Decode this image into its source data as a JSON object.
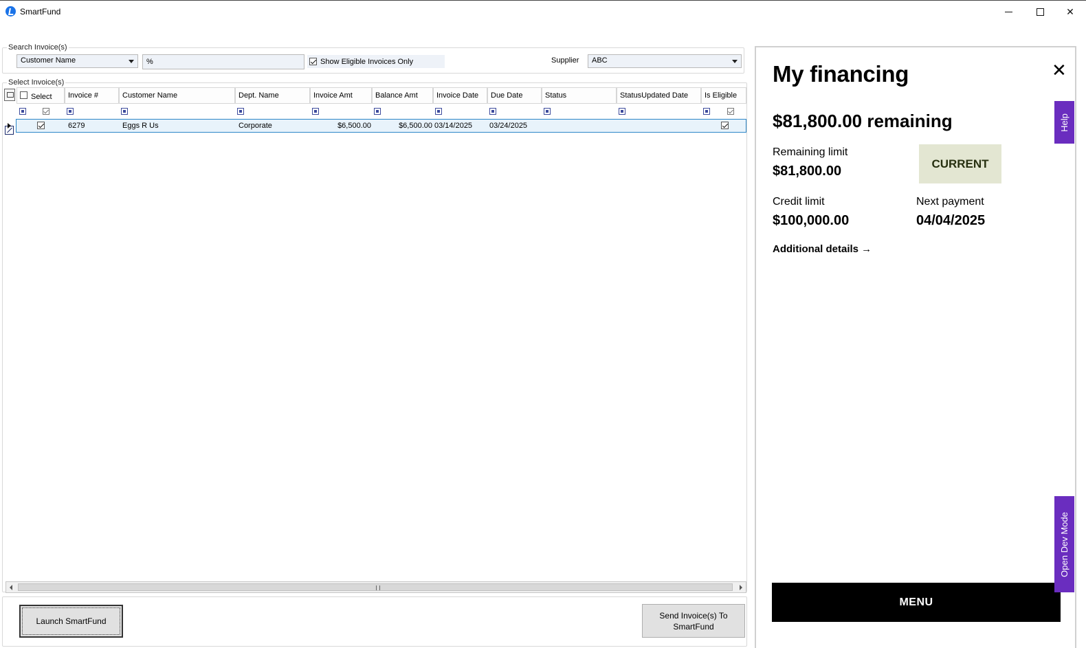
{
  "window": {
    "title": "SmartFund",
    "icons": {
      "app": "smartfund-logo-icon",
      "minimize": "minimize-icon",
      "maximize": "maximize-icon",
      "close": "close-icon"
    }
  },
  "search": {
    "group_label": "Search Invoice(s)",
    "field_selected": "Customer Name",
    "query_value": "%",
    "eligible_label": "Show Eligible Invoices Only",
    "eligible_checked": true,
    "supplier_label": "Supplier",
    "supplier_selected": "ABC"
  },
  "grid": {
    "group_label": "Select Invoice(s)",
    "columns": [
      "Select",
      "Invoice #",
      "Customer Name",
      "Dept. Name",
      "Invoice Amt",
      "Balance Amt",
      "Invoice Date",
      "Due Date",
      "Status",
      "StatusUpdated Date",
      "Is Eligible"
    ],
    "rows": [
      {
        "selected": true,
        "invoice": "6279",
        "customer": "Eggs R Us",
        "dept": "Corporate",
        "invoice_amt": "$6,500.00",
        "balance_amt": "$6,500.00",
        "invoice_date": "03/14/2025",
        "due_date": "03/24/2025",
        "status": "",
        "status_updated": "",
        "eligible": true
      }
    ]
  },
  "actions": {
    "launch_label": "Launch SmartFund",
    "send_label": "Send Invoice(s) To SmartFund"
  },
  "financing": {
    "title": "My financing",
    "remaining_headline": "$81,800.00 remaining",
    "remaining_limit_label": "Remaining limit",
    "remaining_limit_value": "$81,800.00",
    "status_badge": "CURRENT",
    "credit_limit_label": "Credit limit",
    "credit_limit_value": "$100,000.00",
    "next_payment_label": "Next payment",
    "next_payment_value": "04/04/2025",
    "details_link": "Additional details →",
    "menu_label": "MENU",
    "help_tab": "Help",
    "dev_tab": "Open Dev Mode",
    "close_glyph": "✕",
    "colors": {
      "tab": "#6a2dbf",
      "badge_bg": "#e3e6d2",
      "menu_bg": "#000000",
      "row_highlight": "#e8f3fb"
    }
  }
}
